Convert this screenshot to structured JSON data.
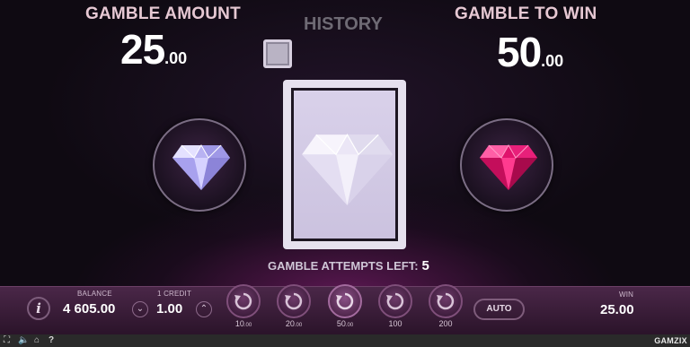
{
  "gamble": {
    "amount_label": "GAMBLE AMOUNT",
    "amount_int": "25",
    "amount_dec": ".00",
    "history_label": "HISTORY",
    "to_win_label": "GAMBLE TO WIN",
    "to_win_int": "50",
    "to_win_dec": ".00",
    "attempts_label": "GAMBLE ATTEMPTS LEFT:",
    "attempts_value": "5",
    "choices": [
      {
        "icon": "white-diamond-icon",
        "color": "#ffffff"
      },
      {
        "icon": "pink-diamond-icon",
        "color": "#ff2d8a"
      }
    ]
  },
  "bar": {
    "balance_label": "BALANCE",
    "balance_value": "4 605.00",
    "credit_label": "1 CREDIT",
    "credit_value": "1.00",
    "bets": [
      {
        "main": "10",
        "small": ".00"
      },
      {
        "main": "20",
        "small": ".00"
      },
      {
        "main": "50",
        "small": ".00"
      },
      {
        "main": "100",
        "small": ""
      },
      {
        "main": "200",
        "small": ""
      }
    ],
    "auto_label": "AUTO",
    "win_label": "WIN",
    "win_value": "25.00"
  },
  "footer": {
    "brand": "GAMZIX",
    "icons": [
      "fullscreen-icon",
      "sound-icon",
      "home-icon",
      "help-icon"
    ]
  }
}
